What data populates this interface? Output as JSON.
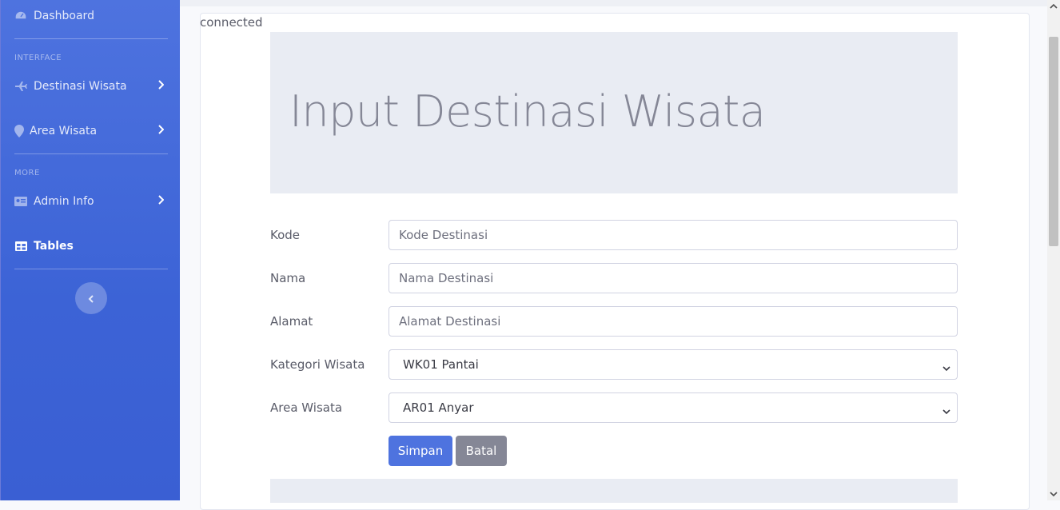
{
  "sidebar": {
    "dashboard": "Dashboard",
    "heading_interface": "INTERFACE",
    "destinasi": "Destinasi Wisata",
    "area": "Area Wisata",
    "heading_more": "MORE",
    "admin": "Admin Info",
    "tables": "Tables"
  },
  "main": {
    "status": "connected",
    "title": "Input Destinasi Wisata",
    "fields": {
      "kode_label": "Kode",
      "kode_placeholder": "Kode Destinasi",
      "nama_label": "Nama",
      "nama_placeholder": "Nama Destinasi",
      "alamat_label": "Alamat",
      "alamat_placeholder": "Alamat Destinasi",
      "kategori_label": "Kategori Wisata",
      "kategori_value": "WK01 Pantai",
      "area_label": "Area Wisata",
      "area_value": "AR01 Anyar"
    },
    "buttons": {
      "save": "Simpan",
      "cancel": "Batal"
    }
  },
  "colors": {
    "sidebar": "#4e73df",
    "primary": "#4e73df",
    "secondary": "#858796"
  }
}
